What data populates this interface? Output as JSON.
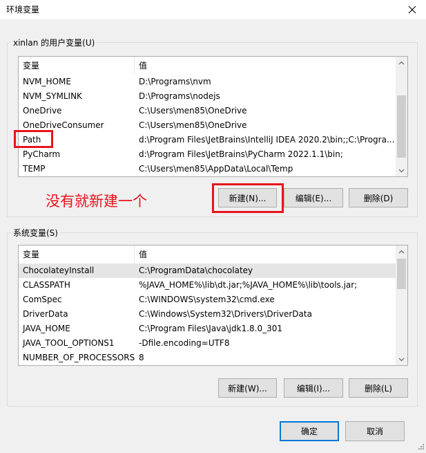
{
  "window": {
    "title": "环境变量"
  },
  "user_section": {
    "label": "xinlan 的用户变量(U)",
    "columns": [
      "变量",
      "值"
    ],
    "rows": [
      {
        "name": "NVM_HOME",
        "value": "D:\\Programs\\nvm"
      },
      {
        "name": "NVM_SYMLINK",
        "value": "D:\\Programs\\nodejs"
      },
      {
        "name": "OneDrive",
        "value": "C:\\Users\\men85\\OneDrive"
      },
      {
        "name": "OneDriveConsumer",
        "value": "C:\\Users\\men85\\OneDrive"
      },
      {
        "name": "Path",
        "value": "d:\\Program Files\\JetBrains\\IntelliJ IDEA 2020.2\\bin;;C:\\Progra..."
      },
      {
        "name": "PyCharm",
        "value": "d:\\Program Files\\JetBrains\\PyCharm 2022.1.1\\bin;"
      },
      {
        "name": "TEMP",
        "value": "C:\\Users\\men85\\AppData\\Local\\Temp"
      }
    ],
    "buttons": {
      "new": "新建(N)...",
      "edit": "编辑(E)...",
      "delete": "删除(D)"
    }
  },
  "annotation": {
    "text": "没有就新建一个",
    "color": "#e8141c"
  },
  "system_section": {
    "label": "系统变量(S)",
    "columns": [
      "变量",
      "值"
    ],
    "rows": [
      {
        "name": "ChocolateyInstall",
        "value": "C:\\ProgramData\\chocolatey"
      },
      {
        "name": "CLASSPATH",
        "value": "%JAVA_HOME%\\lib\\dt.jar;%JAVA_HOME%\\lib\\tools.jar;"
      },
      {
        "name": "ComSpec",
        "value": "C:\\WINDOWS\\system32\\cmd.exe"
      },
      {
        "name": "DriverData",
        "value": "C:\\Windows\\System32\\Drivers\\DriverData"
      },
      {
        "name": "JAVA_HOME",
        "value": "C:\\Program Files\\Java\\jdk1.8.0_301"
      },
      {
        "name": "JAVA_TOOL_OPTIONS1",
        "value": "-Dfile.encoding=UTF8"
      },
      {
        "name": "NUMBER_OF_PROCESSORS",
        "value": "8"
      }
    ],
    "buttons": {
      "new": "新建(W)...",
      "edit": "编辑(I)...",
      "delete": "删除(L)"
    }
  },
  "footer": {
    "ok": "确定",
    "cancel": "取消"
  },
  "icons": {
    "close": "close-icon",
    "scroll_up": "chevron-up-icon",
    "scroll_down": "chevron-down-icon",
    "resize": "resize-grip-icon"
  },
  "colors": {
    "accent": "#0078d7",
    "annotation_red": "#e8141c",
    "selected_row": "#e5e5e5"
  }
}
